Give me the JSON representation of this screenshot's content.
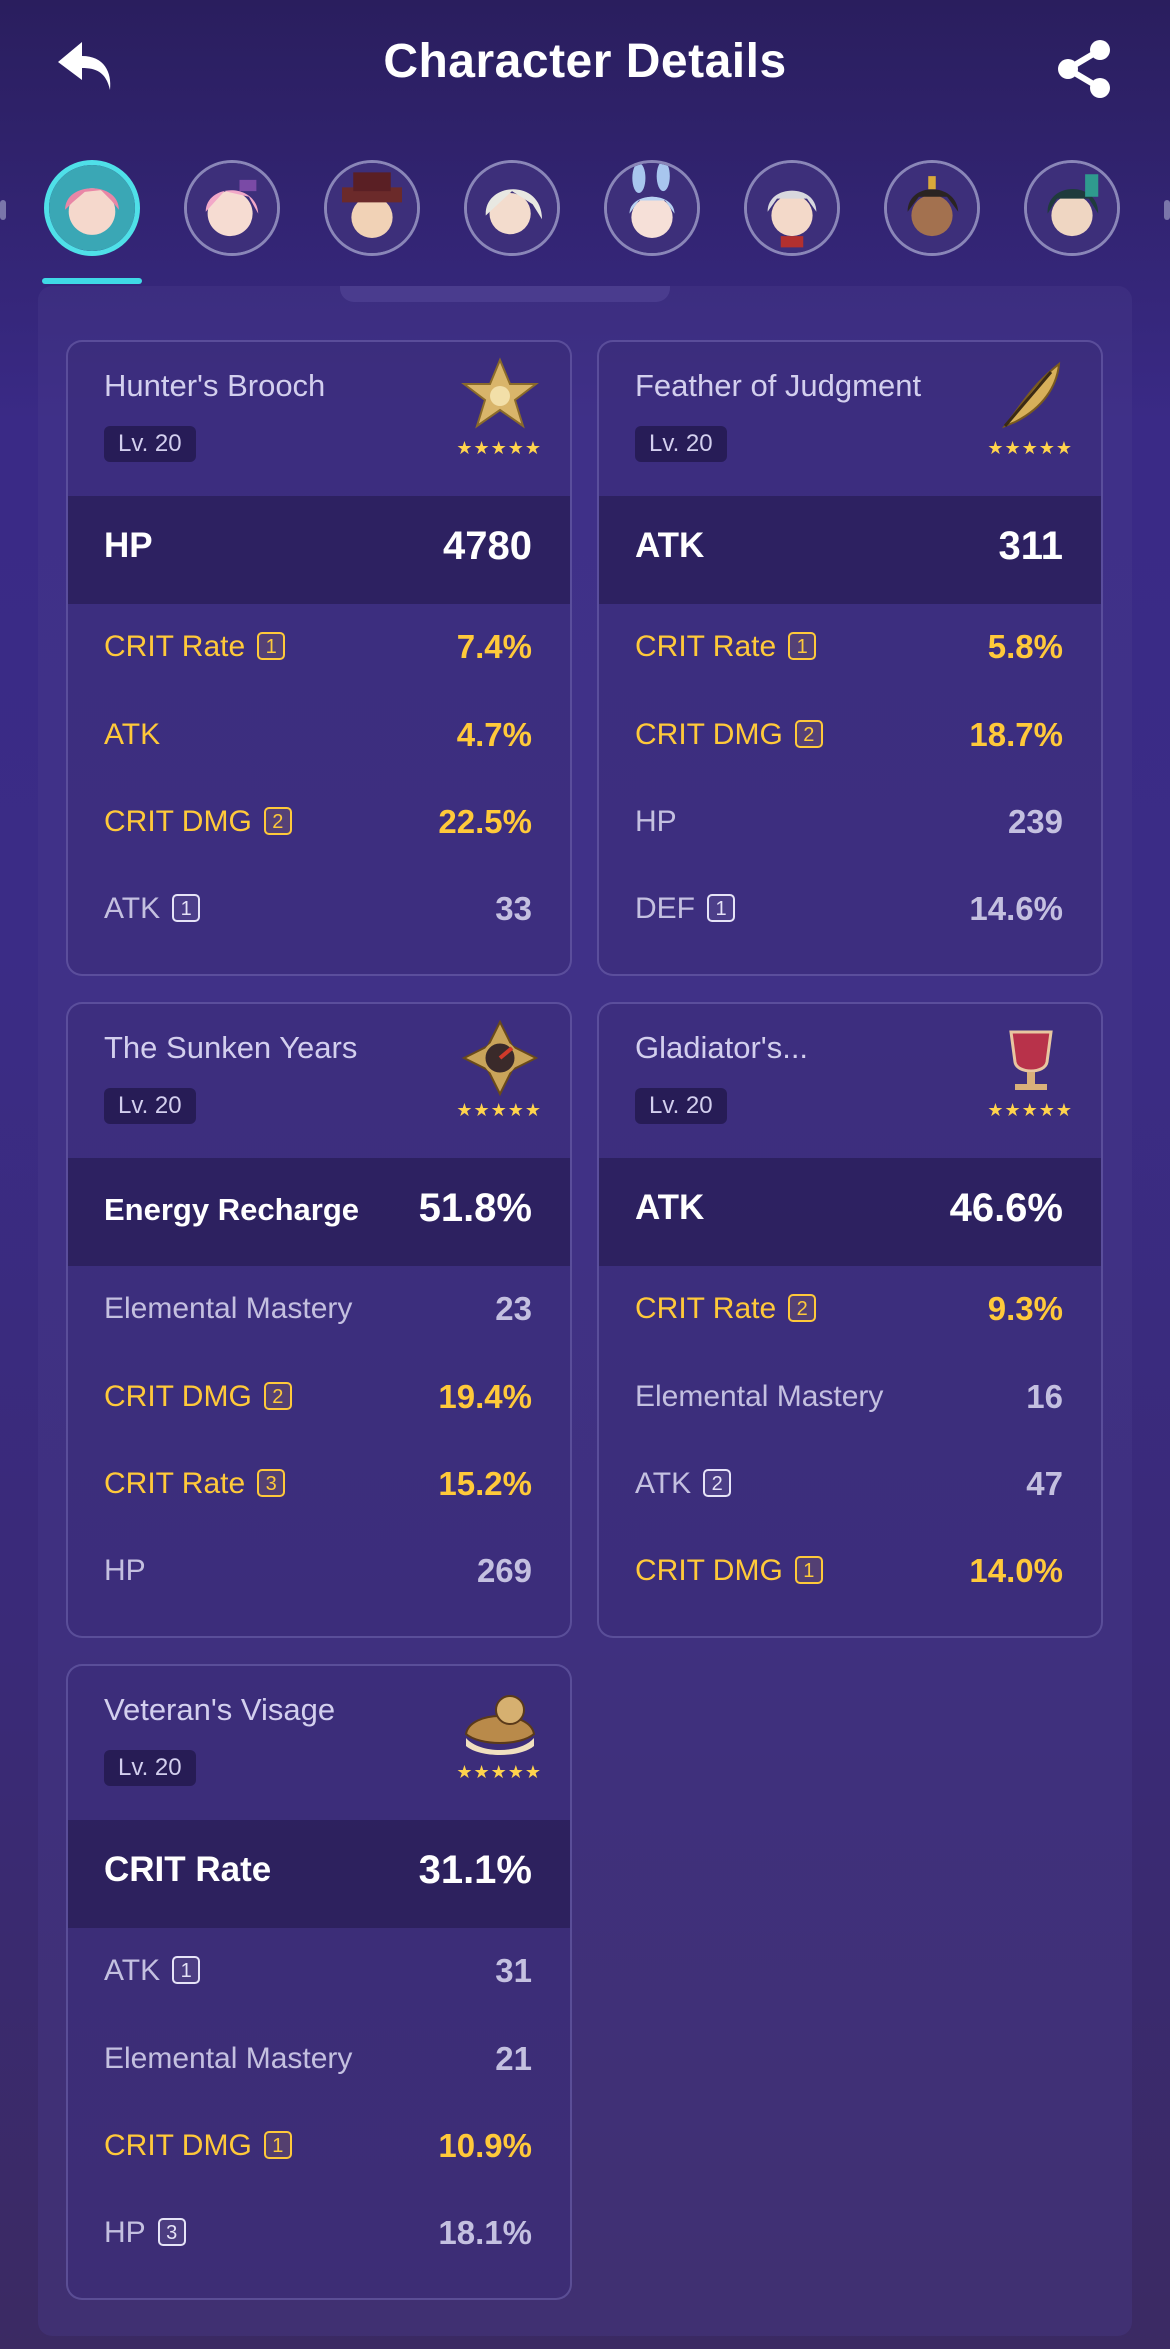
{
  "header": {
    "title": "Character Details"
  },
  "colors": {
    "accent": "#3fd9e6",
    "gold": "#ffc93a",
    "star": "#ffd34d"
  },
  "stars": "★★★★★",
  "artifacts": [
    {
      "name": "Hunter's Brooch",
      "level": "Lv. 20",
      "main_stat": "HP",
      "main_value": "4780",
      "subs": [
        {
          "label": "CRIT Rate",
          "badge": "1",
          "value": "7.4%",
          "gold": true
        },
        {
          "label": "ATK",
          "badge": "",
          "value": "4.7%",
          "gold": true
        },
        {
          "label": "CRIT DMG",
          "badge": "2",
          "value": "22.5%",
          "gold": true
        },
        {
          "label": "ATK",
          "badge": "1",
          "value": "33",
          "gold": false
        }
      ]
    },
    {
      "name": "Feather of Judgment",
      "level": "Lv. 20",
      "main_stat": "ATK",
      "main_value": "311",
      "subs": [
        {
          "label": "CRIT Rate",
          "badge": "1",
          "value": "5.8%",
          "gold": true
        },
        {
          "label": "CRIT DMG",
          "badge": "2",
          "value": "18.7%",
          "gold": true
        },
        {
          "label": "HP",
          "badge": "",
          "value": "239",
          "gold": false
        },
        {
          "label": "DEF",
          "badge": "1",
          "value": "14.6%",
          "gold": false
        }
      ]
    },
    {
      "name": "The Sunken Years",
      "level": "Lv. 20",
      "main_stat": "Energy Recharge",
      "main_value": "51.8%",
      "subs": [
        {
          "label": "Elemental Mastery",
          "badge": "",
          "value": "23",
          "gold": false
        },
        {
          "label": "CRIT DMG",
          "badge": "2",
          "value": "19.4%",
          "gold": true
        },
        {
          "label": "CRIT Rate",
          "badge": "3",
          "value": "15.2%",
          "gold": true
        },
        {
          "label": "HP",
          "badge": "",
          "value": "269",
          "gold": false
        }
      ]
    },
    {
      "name": "Gladiator's...",
      "level": "Lv. 20",
      "main_stat": "ATK",
      "main_value": "46.6%",
      "subs": [
        {
          "label": "CRIT Rate",
          "badge": "2",
          "value": "9.3%",
          "gold": true
        },
        {
          "label": "Elemental Mastery",
          "badge": "",
          "value": "16",
          "gold": false
        },
        {
          "label": "ATK",
          "badge": "2",
          "value": "47",
          "gold": false
        },
        {
          "label": "CRIT DMG",
          "badge": "1",
          "value": "14.0%",
          "gold": true
        }
      ]
    },
    {
      "name": "Veteran's Visage",
      "level": "Lv. 20",
      "main_stat": "CRIT Rate",
      "main_value": "31.1%",
      "subs": [
        {
          "label": "ATK",
          "badge": "1",
          "value": "31",
          "gold": false
        },
        {
          "label": "Elemental Mastery",
          "badge": "",
          "value": "21",
          "gold": false
        },
        {
          "label": "CRIT DMG",
          "badge": "1",
          "value": "10.9%",
          "gold": true
        },
        {
          "label": "HP",
          "badge": "3",
          "value": "18.1%",
          "gold": false
        }
      ]
    }
  ]
}
